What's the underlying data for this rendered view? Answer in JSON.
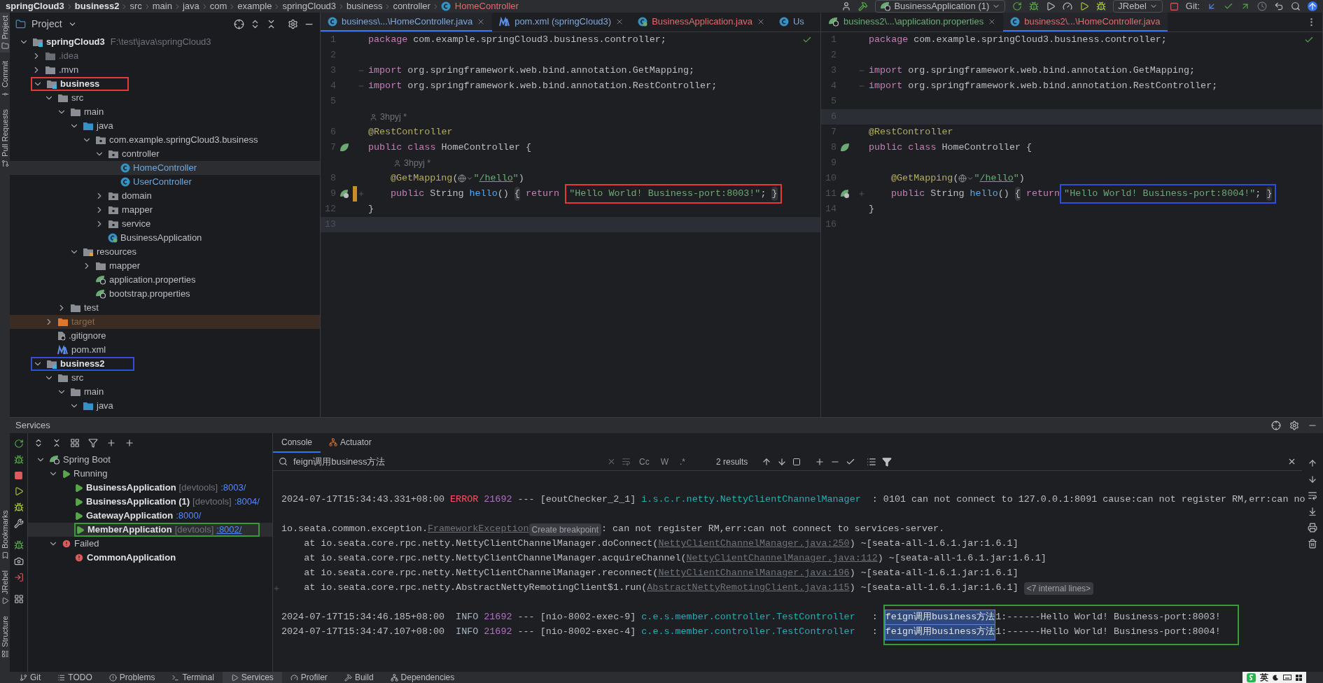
{
  "breadcrumb": {
    "items": [
      {
        "label": "springCloud3",
        "bold": true
      },
      {
        "label": "business2",
        "bold": true
      },
      {
        "label": "src",
        "bold": false
      },
      {
        "label": "main",
        "bold": false
      },
      {
        "label": "java",
        "bold": false
      },
      {
        "label": "com",
        "bold": false
      },
      {
        "label": "example",
        "bold": false
      },
      {
        "label": "springCloud3",
        "bold": false
      },
      {
        "label": "business",
        "bold": false
      },
      {
        "label": "controller",
        "bold": false
      }
    ],
    "file": {
      "label": "HomeController",
      "color": "#e06c6c"
    }
  },
  "toolbar": {
    "run_config": "BusinessApplication (1)",
    "jrebel": "JRebel",
    "git": "Git:"
  },
  "left_strip": {
    "top": [
      {
        "label": "Project",
        "selected": true
      },
      {
        "label": "Commit",
        "selected": false
      },
      {
        "label": "Pull Requests",
        "selected": false
      }
    ],
    "bottom": [
      {
        "label": "Bookmarks",
        "selected": false
      },
      {
        "label": "JRebel",
        "selected": false
      },
      {
        "label": "Structure",
        "selected": false
      }
    ]
  },
  "project": {
    "title": "Project",
    "tree": [
      {
        "label": "springCloud3",
        "detail": "F:\\test\\java\\springCloud3",
        "kind": "module",
        "expanded": true,
        "selected": false,
        "children": [
          {
            "label": ".idea",
            "kind": "ignored",
            "expanded": false,
            "selected": false
          },
          {
            "label": ".mvn",
            "kind": "folder",
            "expanded": false,
            "selected": false
          },
          {
            "label": "business",
            "kind": "module",
            "expanded": true,
            "selected": false,
            "color": "#e53935",
            "children": [
              {
                "label": "src",
                "kind": "folder",
                "expanded": true,
                "selected": false,
                "children": [
                  {
                    "label": "main",
                    "kind": "folder",
                    "expanded": true,
                    "selected": false,
                    "children": [
                      {
                        "label": "java",
                        "kind": "source",
                        "expanded": true,
                        "selected": false,
                        "children": [
                          {
                            "label": "com.example.springCloud3.business",
                            "kind": "package",
                            "expanded": true,
                            "selected": false,
                            "children": [
                              {
                                "label": "controller",
                                "kind": "package",
                                "expanded": true,
                                "selected": false,
                                "children": [
                                  {
                                    "label": "HomeController",
                                    "kind": "class",
                                    "selected": true
                                  },
                                  {
                                    "label": "UserController",
                                    "kind": "class",
                                    "selected": false
                                  }
                                ]
                              },
                              {
                                "label": "domain",
                                "kind": "package",
                                "expanded": false,
                                "selected": false
                              },
                              {
                                "label": "mapper",
                                "kind": "package",
                                "expanded": false,
                                "selected": false
                              },
                              {
                                "label": "service",
                                "kind": "package",
                                "expanded": false,
                                "selected": false
                              },
                              {
                                "label": "BusinessApplication",
                                "kind": "spring_class",
                                "selected": false
                              }
                            ]
                          }
                        ]
                      },
                      {
                        "label": "resources",
                        "kind": "resources",
                        "expanded": true,
                        "selected": false,
                        "children": [
                          {
                            "label": "mapper",
                            "kind": "folder",
                            "expanded": false,
                            "selected": false
                          },
                          {
                            "label": "application.properties",
                            "kind": "spring_props",
                            "selected": false
                          },
                          {
                            "label": "bootstrap.properties",
                            "kind": "spring_props",
                            "selected": false
                          }
                        ]
                      }
                    ]
                  },
                  {
                    "label": "test",
                    "kind": "folder",
                    "expanded": false,
                    "selected": false
                  }
                ]
              },
              {
                "label": "target",
                "kind": "excluded",
                "expanded": false,
                "selected": false
              },
              {
                "label": ".gitignore",
                "kind": "git_file",
                "selected": false
              },
              {
                "label": "pom.xml",
                "kind": "maven",
                "selected": false
              }
            ]
          },
          {
            "label": "business2",
            "kind": "module",
            "expanded": true,
            "selected": false,
            "color": "#2f4fd8",
            "children": [
              {
                "label": "src",
                "kind": "folder",
                "expanded": true,
                "selected": false,
                "children": [
                  {
                    "label": "main",
                    "kind": "folder",
                    "expanded": true,
                    "selected": false,
                    "children": [
                      {
                        "label": "java",
                        "kind": "source",
                        "expanded": true,
                        "selected": false
                      }
                    ]
                  }
                ]
              }
            ]
          }
        ]
      }
    ]
  },
  "editors": [
    {
      "tabs": [
        {
          "label": "business\\...\\HomeController.java",
          "kind": "class",
          "color": "#7fa7d6",
          "selected": true
        },
        {
          "label": "pom.xml (springCloud3)",
          "kind": "maven",
          "color": "#7fa7d6",
          "selected": false
        },
        {
          "label": "BusinessApplication.java",
          "kind": "spring_class",
          "color": "#e06c6c",
          "selected": false
        },
        {
          "label": "Us",
          "kind": "class",
          "color": "#7fa7d6",
          "selected": false
        }
      ],
      "lines": [
        {
          "kind": "code",
          "number": "1",
          "current": false,
          "tokens": [
            {
              "kind": "kw",
              "text": "package"
            },
            {
              "kind": "plain",
              "text": " com.example.springCloud3.business.controller;"
            }
          ]
        },
        {
          "kind": "code",
          "number": "2",
          "current": false
        },
        {
          "kind": "code",
          "number": "3",
          "current": false,
          "fold": true,
          "tokens": [
            {
              "kind": "kw",
              "text": "import"
            },
            {
              "kind": "plain",
              "text": " org.springframework.web.bind.annotation.GetMapping;"
            }
          ]
        },
        {
          "kind": "code",
          "number": "4",
          "current": false,
          "fold": true,
          "tokens": [
            {
              "kind": "kw",
              "text": "import"
            },
            {
              "kind": "plain",
              "text": " org.springframework.web.bind.annotation.RestController;"
            }
          ]
        },
        {
          "kind": "code",
          "number": "5",
          "current": false
        },
        {
          "kind": "code",
          "number": "6",
          "current": false,
          "author": "3hpyj *",
          "tokens": [
            {
              "kind": "ann",
              "text": "@RestController"
            }
          ]
        },
        {
          "kind": "code",
          "number": "7",
          "current": false,
          "gutter": {
            "kind": "bean"
          },
          "tokens": [
            {
              "kind": "kw",
              "text": "public class"
            },
            {
              "kind": "plain",
              "text": " HomeController {"
            }
          ]
        },
        {
          "kind": "code",
          "number": "8",
          "current": false,
          "nested": true,
          "author": "3hpyj *",
          "tokens": [
            {
              "kind": "ann",
              "text": "@GetMapping"
            },
            {
              "kind": "plain",
              "text": "("
            },
            {
              "kind": "globe"
            },
            {
              "kind": "str",
              "text": "\""
            },
            {
              "kind": "url",
              "text": "/hello"
            },
            {
              "kind": "str",
              "text": "\""
            },
            {
              "kind": "plain",
              "text": ")"
            }
          ]
        },
        {
          "kind": "code",
          "number": "9",
          "current": false,
          "nested": true,
          "gutter": {
            "kind": "web"
          },
          "changed": true,
          "expand": true,
          "tokens": [
            {
              "kind": "kw",
              "text": "public"
            },
            {
              "kind": "plain",
              "text": " String "
            },
            {
              "kind": "fn",
              "text": "hello"
            },
            {
              "kind": "plain",
              "text": "() "
            },
            {
              "kind": "fold",
              "text": "{"
            },
            {
              "kind": "kw",
              "text": " return "
            }
          ],
          "box": {
            "color": "#e53935",
            "tokens": [
              {
                "kind": "str",
                "text": "\"Hello World! Business-port:8003!\""
              },
              {
                "kind": "plain",
                "text": "; "
              },
              {
                "kind": "fold",
                "text": "}"
              }
            ]
          }
        },
        {
          "kind": "code",
          "number": "12",
          "current": false,
          "tokens": [
            {
              "kind": "plain",
              "text": "}"
            }
          ]
        },
        {
          "kind": "code",
          "number": "13",
          "current": true
        }
      ]
    },
    {
      "tabs": [
        {
          "label": "business2\\...\\application.properties",
          "kind": "spring_props",
          "color": "#6aab73",
          "selected": false
        },
        {
          "label": "business2\\...\\HomeController.java",
          "kind": "class",
          "color": "#e06c6c",
          "selected": true
        }
      ],
      "lines": [
        {
          "kind": "code",
          "number": "1",
          "current": false,
          "tokens": [
            {
              "kind": "kw",
              "text": "package"
            },
            {
              "kind": "plain",
              "text": " com.example.springCloud3.business.controller;"
            }
          ]
        },
        {
          "kind": "code",
          "number": "2",
          "current": false
        },
        {
          "kind": "code",
          "number": "3",
          "current": false,
          "fold": true,
          "tokens": [
            {
              "kind": "kw",
              "text": "import"
            },
            {
              "kind": "plain",
              "text": " org.springframework.web.bind.annotation.GetMapping;"
            }
          ]
        },
        {
          "kind": "code",
          "number": "4",
          "current": false,
          "fold": true,
          "tokens": [
            {
              "kind": "kw",
              "text": "import"
            },
            {
              "kind": "plain",
              "text": " org.springframework.web.bind.annotation.RestController;"
            }
          ]
        },
        {
          "kind": "code",
          "number": "5",
          "current": false
        },
        {
          "kind": "code",
          "number": "6",
          "current": true
        },
        {
          "kind": "code",
          "number": "7",
          "current": false,
          "tokens": [
            {
              "kind": "ann",
              "text": "@RestController"
            }
          ]
        },
        {
          "kind": "code",
          "number": "8",
          "current": false,
          "gutter": {
            "kind": "bean"
          },
          "tokens": [
            {
              "kind": "kw",
              "text": "public class"
            },
            {
              "kind": "plain",
              "text": " HomeController {"
            }
          ]
        },
        {
          "kind": "code",
          "number": "9",
          "current": false
        },
        {
          "kind": "code",
          "number": "10",
          "current": false,
          "nested": true,
          "tokens": [
            {
              "kind": "ann",
              "text": "@GetMapping"
            },
            {
              "kind": "plain",
              "text": "("
            },
            {
              "kind": "globe"
            },
            {
              "kind": "str",
              "text": "\""
            },
            {
              "kind": "url",
              "text": "/hello"
            },
            {
              "kind": "str",
              "text": "\""
            },
            {
              "kind": "plain",
              "text": ")"
            }
          ]
        },
        {
          "kind": "code",
          "number": "11",
          "current": false,
          "nested": true,
          "gutter": {
            "kind": "web"
          },
          "expand": true,
          "tokens": [
            {
              "kind": "kw",
              "text": "public"
            },
            {
              "kind": "plain",
              "text": " String "
            },
            {
              "kind": "fn",
              "text": "hello"
            },
            {
              "kind": "plain",
              "text": "() "
            },
            {
              "kind": "fold",
              "text": "{"
            },
            {
              "kind": "kw",
              "text": " return"
            }
          ],
          "box": {
            "color": "#2f4fd8",
            "tokens": [
              {
                "kind": "str",
                "text": "\"Hello World! Business-port:8004!\""
              },
              {
                "kind": "plain",
                "text": "; "
              },
              {
                "kind": "fold",
                "text": "}"
              }
            ]
          }
        },
        {
          "kind": "code",
          "number": "14",
          "current": false,
          "tokens": [
            {
              "kind": "plain",
              "text": "}"
            }
          ]
        },
        {
          "kind": "code",
          "number": "16",
          "current": false
        }
      ]
    }
  ],
  "services": {
    "title": "Services",
    "tree": [
      {
        "label": "Spring Boot",
        "kind": "spring",
        "expanded": true,
        "selected": false,
        "children": [
          {
            "label": "Running",
            "kind": "running",
            "expanded": true,
            "selected": false,
            "children": [
              {
                "label": "BusinessApplication",
                "tag": "[devtools]",
                "port": ":8003/",
                "kind": "app_running",
                "selected": false
              },
              {
                "label": "BusinessApplication (1)",
                "tag": "[devtools]",
                "port": ":8004/",
                "kind": "app_running",
                "selected": false
              },
              {
                "label": "GatewayApplication",
                "port": ":8000/",
                "kind": "app_running",
                "selected": false
              },
              {
                "label": "MemberApplication",
                "tag": "[devtools]",
                "port": ":8002/",
                "kind": "app_running",
                "selected": true,
                "color": "#3a9a3a"
              }
            ]
          },
          {
            "label": "Failed",
            "kind": "failed",
            "expanded": true,
            "selected": false,
            "children": [
              {
                "label": "CommonApplication",
                "kind": "app_failed",
                "selected": false
              }
            ]
          }
        ]
      }
    ]
  },
  "console": {
    "tabs": [
      {
        "label": "Console",
        "selected": true
      },
      {
        "label": "Actuator",
        "selected": false
      }
    ],
    "search": {
      "value": "feign调用business方法",
      "options": [
        {
          "label": "Cc",
          "selected": false
        },
        {
          "label": "W",
          "selected": false
        },
        {
          "label": ".*",
          "selected": false
        }
      ],
      "results": "2 results"
    },
    "lines": [
      {
        "kind": "blank"
      },
      {
        "kind": "text",
        "segments": [
          {
            "kind": "plain",
            "text": "2024-07-17T15:34:43.331+08:00 "
          },
          {
            "kind": "error",
            "text": "ERROR"
          },
          {
            "kind": "pid",
            "text": " 21692"
          },
          {
            "kind": "plain",
            "text": " --- [eoutChecker_2_1] "
          },
          {
            "kind": "logger",
            "text": "i.s.c.r.netty.NettyClientChannelManager"
          },
          {
            "kind": "plain",
            "text": "  : 0101 can not connect to 127.0.0.1:8091 cause:can not register RM,err:can no"
          }
        ]
      },
      {
        "kind": "blank"
      },
      {
        "kind": "text",
        "segments": [
          {
            "kind": "plain",
            "text": "io.seata.common.exception."
          },
          {
            "kind": "link",
            "text": "FrameworkException"
          },
          {
            "kind": "hint",
            "text": "Create breakpoint"
          },
          {
            "kind": "plain",
            "text": ": can not register RM,err:can not connect to services-server."
          }
        ]
      },
      {
        "kind": "text",
        "segments": [
          {
            "kind": "plain",
            "text": "    at io.seata.core.rpc.netty.NettyClientChannelManager.doConnect("
          },
          {
            "kind": "link",
            "text": "NettyClientChannelManager.java:250"
          },
          {
            "kind": "plain",
            "text": ") ~[seata-all-1.6.1.jar:1.6.1]"
          }
        ]
      },
      {
        "kind": "text",
        "segments": [
          {
            "kind": "plain",
            "text": "    at io.seata.core.rpc.netty.NettyClientChannelManager.acquireChannel("
          },
          {
            "kind": "link",
            "text": "NettyClientChannelManager.java:112"
          },
          {
            "kind": "plain",
            "text": ") ~[seata-all-1.6.1.jar:1.6.1]"
          }
        ]
      },
      {
        "kind": "text",
        "segments": [
          {
            "kind": "plain",
            "text": "    at io.seata.core.rpc.netty.NettyClientChannelManager.reconnect("
          },
          {
            "kind": "link",
            "text": "NettyClientChannelManager.java:196"
          },
          {
            "kind": "plain",
            "text": ") ~[seata-all-1.6.1.jar:1.6.1]"
          }
        ]
      },
      {
        "kind": "text",
        "expand": true,
        "segments": [
          {
            "kind": "plain",
            "text": "    at io.seata.core.rpc.netty.AbstractNettyRemotingClient$1.run("
          },
          {
            "kind": "link",
            "text": "AbstractNettyRemotingClient.java:115"
          },
          {
            "kind": "plain",
            "text": ") ~[seata-all-1.6.1.jar:1.6.1] "
          },
          {
            "kind": "hint",
            "text": "<7 internal lines>"
          }
        ]
      },
      {
        "kind": "blank"
      }
    ],
    "group": {
      "color": "#3a9a3a",
      "entries": [
        {
          "prefix": [
            {
              "kind": "plain",
              "text": "2024-07-17T15:34:46.185+08:00  "
            },
            {
              "kind": "info",
              "text": "INFO"
            },
            {
              "kind": "pid",
              "text": " 21692"
            },
            {
              "kind": "plain",
              "text": " --- [nio-8002-exec-9] "
            },
            {
              "kind": "logger",
              "text": "c.e.s.member.controller.TestController"
            },
            {
              "kind": "plain",
              "text": "   :"
            }
          ],
          "message": [
            {
              "kind": "match",
              "text": "feign调用business方法"
            },
            {
              "kind": "plain",
              "text": "1:------Hello World! Business-port:8003!"
            }
          ]
        },
        {
          "prefix": [
            {
              "kind": "plain",
              "text": "2024-07-17T15:34:47.107+08:00  "
            },
            {
              "kind": "info",
              "text": "INFO"
            },
            {
              "kind": "pid",
              "text": " 21692"
            },
            {
              "kind": "plain",
              "text": " --- [nio-8002-exec-4] "
            },
            {
              "kind": "logger",
              "text": "c.e.s.member.controller.TestController"
            },
            {
              "kind": "plain",
              "text": "   :"
            }
          ],
          "message": [
            {
              "kind": "match",
              "text": "feign调用business方法"
            },
            {
              "kind": "plain",
              "text": "1:------Hello World! Business-port:8004!"
            }
          ]
        }
      ]
    }
  },
  "bottom_tabs": [
    {
      "label": "Git",
      "selected": false
    },
    {
      "label": "TODO",
      "selected": false
    },
    {
      "label": "Problems",
      "selected": false
    },
    {
      "label": "Terminal",
      "selected": false
    },
    {
      "label": "Services",
      "selected": true
    },
    {
      "label": "Profiler",
      "selected": false
    },
    {
      "label": "Build",
      "selected": false
    },
    {
      "label": "Dependencies",
      "selected": false
    }
  ],
  "ime": {
    "label": "英"
  }
}
